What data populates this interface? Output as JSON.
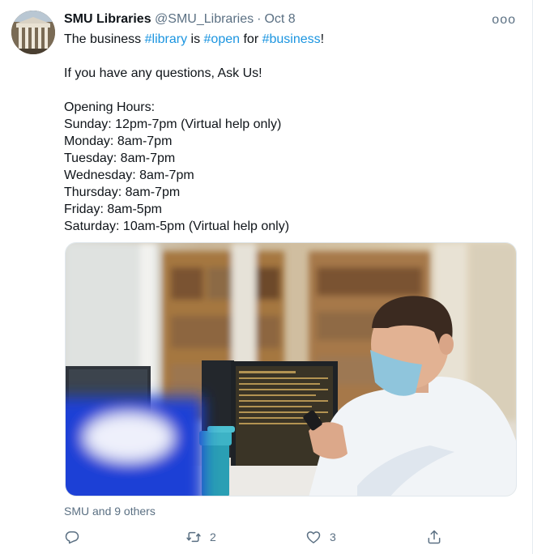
{
  "tweet": {
    "author_name": "SMU Libraries",
    "author_handle": "@SMU_Libraries",
    "separator": "·",
    "date": "Oct 8",
    "more_label": "ooo",
    "line1_prefix": "The business ",
    "hashtag_library": "#library",
    "line1_is": " is ",
    "hashtag_open": "#open",
    "line1_for": " for ",
    "hashtag_business": "#business",
    "line1_suffix": "!",
    "questions": "If you have any questions, Ask Us!",
    "hours_title": "Opening Hours:",
    "hours": [
      "Sunday: 12pm-7pm (Virtual help only)",
      "Monday: 8am-7pm",
      "Tuesday: 8am-7pm",
      "Wednesday: 8am-7pm",
      "Thursday: 8am-7pm",
      "Friday: 8am-5pm",
      "Saturday: 10am-5pm (Virtual help only)"
    ],
    "liked_by": "SMU and 9 others",
    "retweet_count": "2",
    "like_count": "3"
  },
  "icons": {
    "reply": "reply-icon",
    "retweet": "retweet-icon",
    "like": "heart-icon",
    "share": "share-icon",
    "more": "more-icon"
  },
  "colors": {
    "link": "#1b95e0",
    "secondary_text": "#5b7083",
    "primary_text": "#0f1419"
  }
}
